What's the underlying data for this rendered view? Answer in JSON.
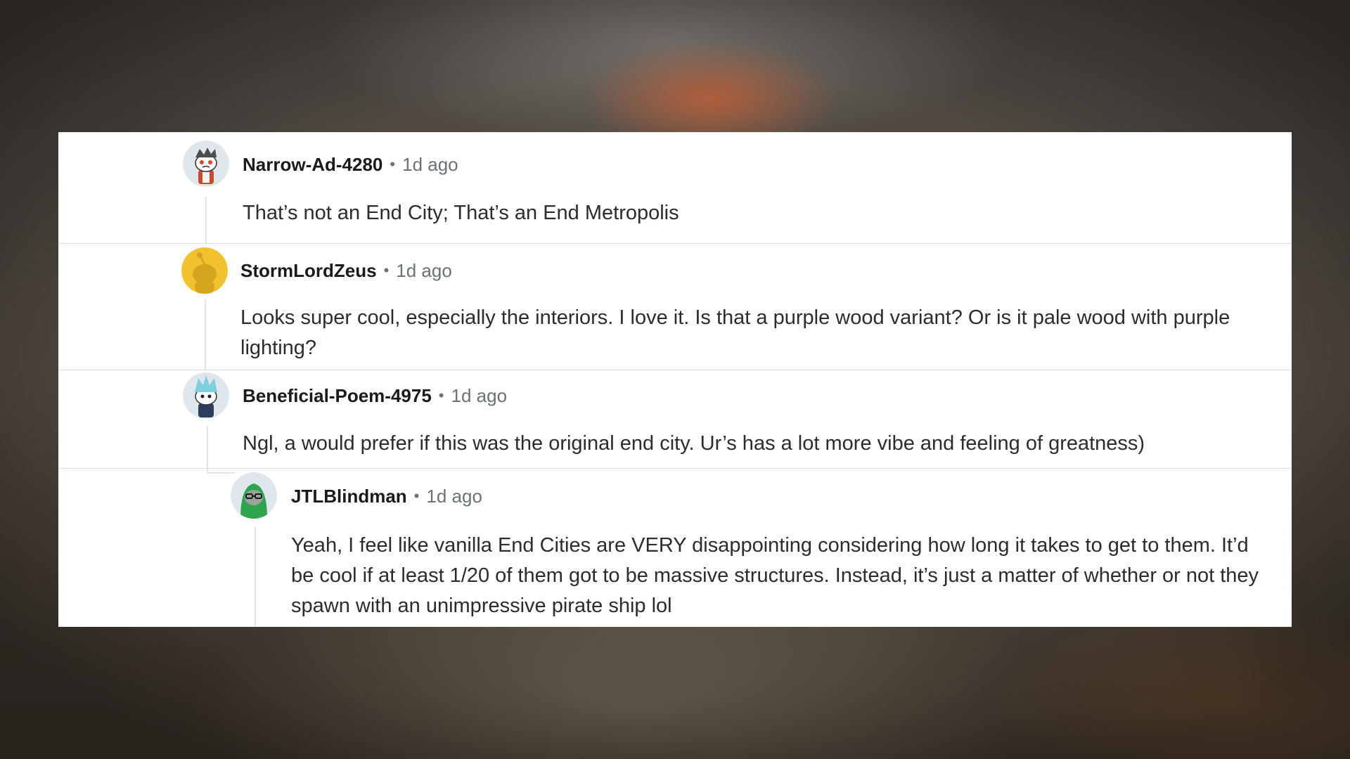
{
  "comments": [
    {
      "username": "Narrow-Ad-4280",
      "separator": "•",
      "time": "1d ago",
      "text": "That’s not an End City; That’s an End Metropolis"
    },
    {
      "username": "StormLordZeus",
      "separator": "•",
      "time": "1d ago",
      "text": "Looks super cool, especially the interiors. I love it. Is that a purple wood variant? Or is it pale wood with purple lighting?"
    },
    {
      "username": "Beneficial-Poem-4975",
      "separator": "•",
      "time": "1d ago",
      "text": "Ngl, a would prefer if this was the original end city. Ur’s has a lot more vibe and feeling of greatness)"
    },
    {
      "username": "JTLBlindman",
      "separator": "•",
      "time": "1d ago",
      "text": "Yeah, I feel like vanilla End Cities are VERY disappointing considering how long it takes to get to them. It’d be cool if at least 1/20 of them got to be massive structures. Instead, it’s just a matter of whether or not they spawn with an unimpressive pirate ship lol"
    }
  ],
  "colors": {
    "panel_bg": "#ffffff",
    "username": "#1a1a1b",
    "meta": "#6a7278",
    "body": "#2a2c2e",
    "divider": "#d9dcde",
    "avatar_yellow": "#f2c12e",
    "avatar_green": "#2ea44f"
  },
  "icons": [
    "snoo-avatar-red-eyes",
    "snoo-avatar-yellow-default",
    "snoo-avatar-blue-hair",
    "snoo-avatar-green-hood"
  ]
}
